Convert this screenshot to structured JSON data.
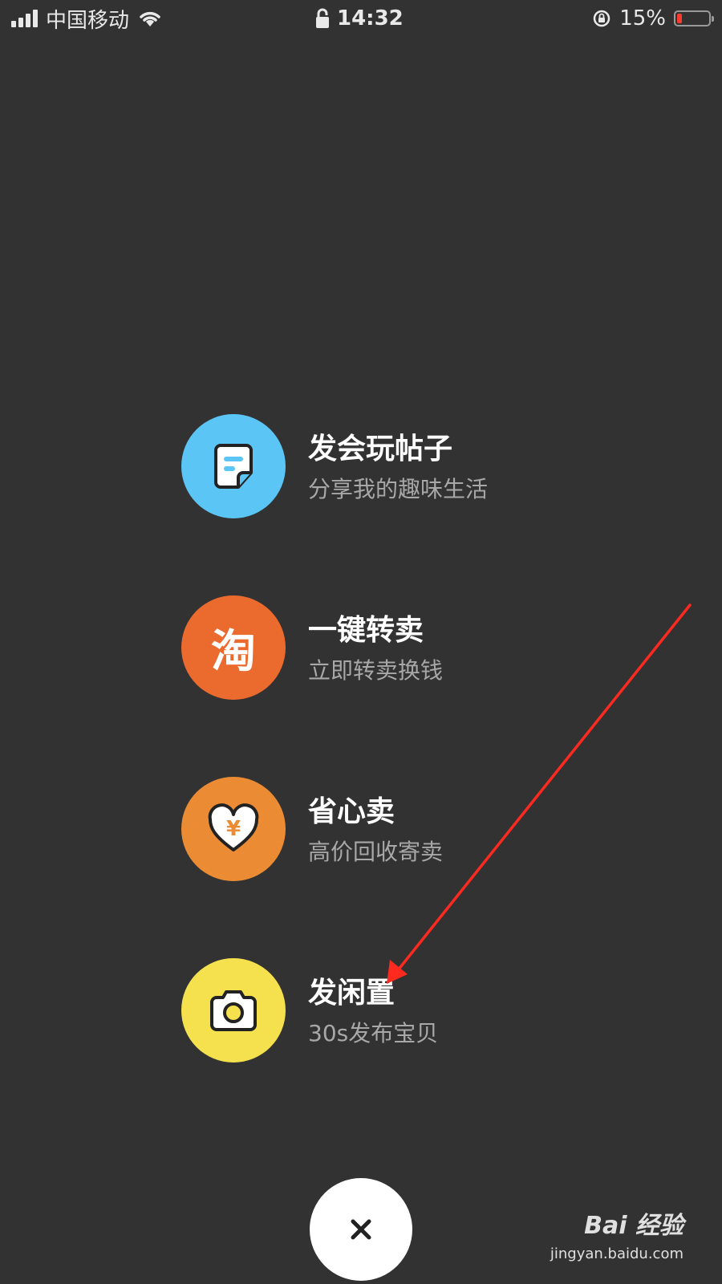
{
  "status_bar": {
    "carrier": "中国移动",
    "time": "14:32",
    "battery": "15%",
    "battery_level": 0.15,
    "icons": [
      "signal-icon",
      "wifi-icon",
      "lock-icon",
      "rotation-lock-icon",
      "battery-icon"
    ]
  },
  "menu": {
    "items": [
      {
        "title": "发会玩帖子",
        "subtitle": "分享我的趣味生活",
        "icon": "note-icon",
        "color": "#5bc6f5"
      },
      {
        "title": "一键转卖",
        "subtitle": "立即转卖换钱",
        "icon": "taobao-icon",
        "color": "#eb6a2e",
        "icon_text": "淘"
      },
      {
        "title": "省心卖",
        "subtitle": "高价回收寄卖",
        "icon": "heart-yuan-icon",
        "color": "#eb8c34",
        "icon_text": "¥"
      },
      {
        "title": "发闲置",
        "subtitle": "30s发布宝贝",
        "icon": "camera-icon",
        "color": "#f5e14e"
      }
    ]
  },
  "close_button": {
    "icon": "close-icon",
    "label": "×"
  },
  "annotation": {
    "icon": "red-arrow-icon",
    "color": "#ff2a1f"
  },
  "watermark": {
    "brand": "Bai 经验",
    "url": "jingyan.baidu.com"
  }
}
